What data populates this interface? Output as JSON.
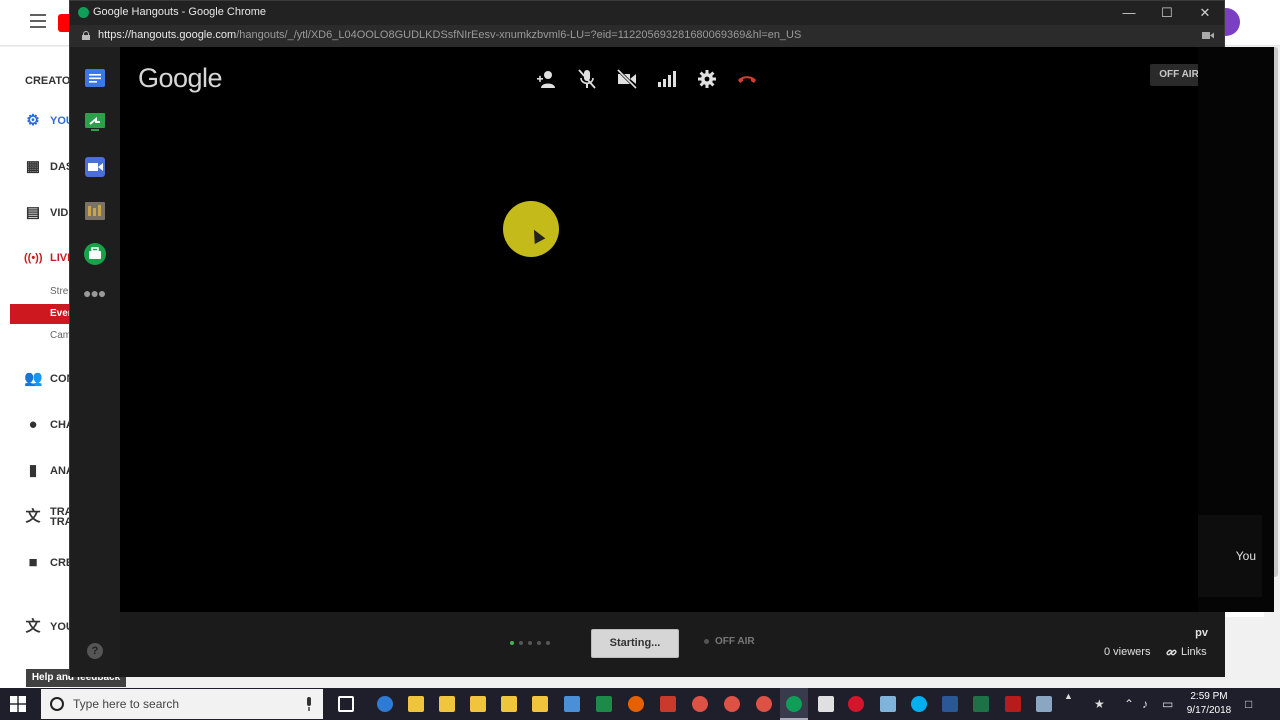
{
  "background_app": {
    "section_label": "CREATO",
    "nav_items": [
      {
        "label": "YOU",
        "icon": "gear-icon"
      },
      {
        "label": "DAS",
        "icon": "dashboard-icon"
      },
      {
        "label": "VIDE",
        "icon": "video-manager-icon"
      },
      {
        "label": "LIVE",
        "icon": "live-broadcast-icon"
      },
      {
        "label": "COM",
        "icon": "community-icon"
      },
      {
        "label": "CHA",
        "icon": "channel-icon"
      },
      {
        "label": "ANA",
        "icon": "analytics-icon"
      },
      {
        "label": "TRA",
        "label2": "TRA",
        "icon": "translate-icon"
      },
      {
        "label": "CRE",
        "icon": "create-icon"
      },
      {
        "label": "YOU",
        "icon": "translate-icon"
      }
    ],
    "live_sub_items": [
      "Stre",
      "Even",
      "Cam"
    ],
    "active_sub_item": "Even",
    "help_feedback": "Help and feedback"
  },
  "window": {
    "title": "Google Hangouts - Google Chrome",
    "url_host": "https://hangouts.google.com",
    "url_path": "/hangouts/_/ytl/XD6_L04OOLO8GUDLKDSsfNIrEesv-xnumkzbvml6-LU=?eid=112205693281680069369&hl=en_US"
  },
  "hangout": {
    "logo_text": "Google",
    "toolbar": [
      "invite-people-icon",
      "mic-muted-icon",
      "camera-off-icon",
      "bandwidth-icon",
      "settings-icon",
      "hang-up-icon"
    ],
    "off_air_top": "OFF AIR",
    "self_label": "You",
    "starting_button": "Starting...",
    "off_air_status": "OFF AIR",
    "user_initials": "pv",
    "viewers": "0 viewers",
    "links": "Links"
  },
  "taskbar": {
    "search_placeholder": "Type here to search",
    "time": "2:59 PM",
    "date": "9/17/2018"
  },
  "colors": {
    "youtube_red": "#cc181e",
    "hangouts_green": "#0f9d58",
    "hangup_red": "#d23f31",
    "cursor_halo": "#e6dc1e"
  }
}
